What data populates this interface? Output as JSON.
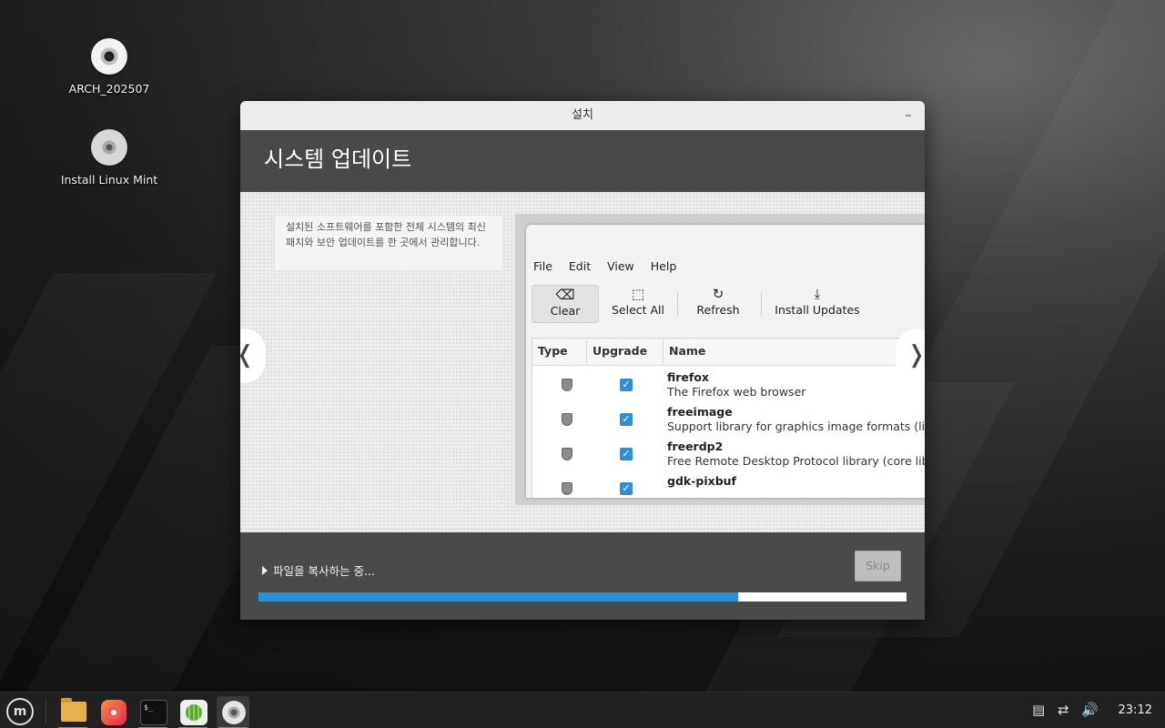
{
  "desktop": {
    "icons": [
      {
        "label": "ARCH_202507"
      },
      {
        "label": "Install Linux Mint"
      }
    ]
  },
  "window": {
    "title": "설치",
    "minimize_glyph": "–",
    "header_title": "시스템 업데이트",
    "slide": {
      "description": "설치된 소프트웨어를 포함한 전체 시스템의 최신 패치와 보안 업데이트를 한 곳에서 관리합니다.",
      "prev_glyph": "❬",
      "next_glyph": "❭",
      "update_manager": {
        "menu": [
          "File",
          "Edit",
          "View",
          "Help"
        ],
        "toolbar": {
          "clear": "Clear",
          "select_all": "Select All",
          "refresh": "Refresh",
          "install_updates": "Install Updates"
        },
        "columns": {
          "type": "Type",
          "upgrade": "Upgrade",
          "name": "Name"
        },
        "packages": [
          {
            "name": "firefox",
            "desc": "The Firefox web browser"
          },
          {
            "name": "freeimage",
            "desc": "Support library for graphics image formats (libr"
          },
          {
            "name": "freerdp2",
            "desc": "Free Remote Desktop Protocol library (core libr"
          },
          {
            "name": "gdk-pixbuf",
            "desc": ""
          }
        ]
      }
    },
    "footer": {
      "status": "파일을 복사하는 중...",
      "skip_label": "Skip",
      "progress_fraction": 0.74
    }
  },
  "taskbar": {
    "clock": "23:12"
  }
}
